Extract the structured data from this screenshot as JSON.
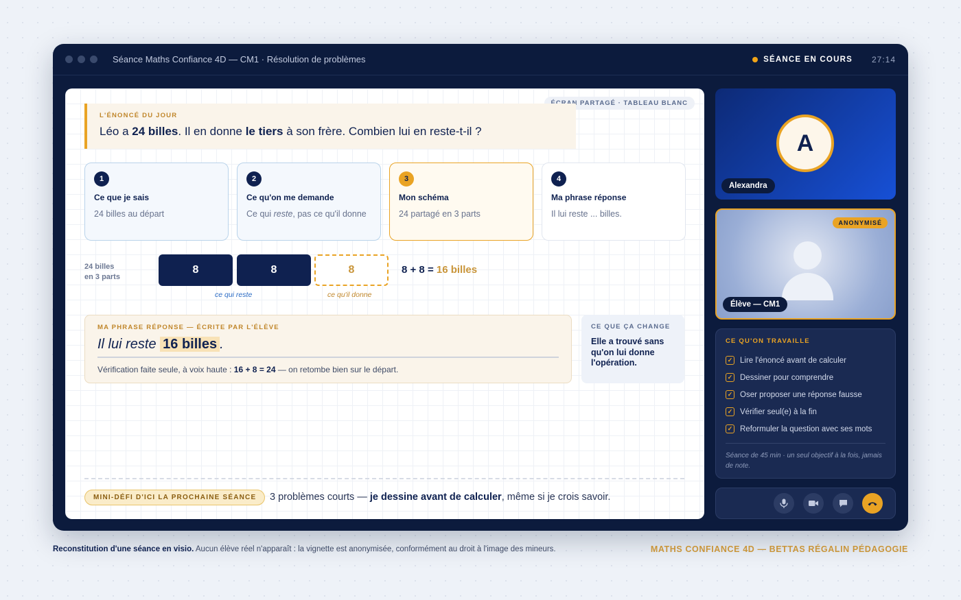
{
  "window": {
    "title": "Séance Maths Confiance 4D — CM1 · Résolution de problèmes",
    "status": "SÉANCE EN COURS",
    "timer": "27:14"
  },
  "board": {
    "share_tag": "ÉCRAN PARTAGÉ · TABLEAU BLANC",
    "enonce": {
      "kicker": "L'ÉNONCÉ DU JOUR",
      "p1": "Léo a ",
      "b1": "24 billes",
      "p2": ". Il en donne ",
      "b2": "le tiers",
      "p3": " à son frère. Combien lui en reste-t-il ?"
    },
    "steps": [
      {
        "num": "1",
        "title": "Ce que je sais",
        "desc": "24 billes au départ"
      },
      {
        "num": "2",
        "title": "Ce qu'on me demande",
        "desc_a": "Ce qui ",
        "desc_i": "reste",
        "desc_b": ", pas ce qu'il donne"
      },
      {
        "num": "3",
        "title": "Mon schéma",
        "desc": "24 partagé en 3 parts"
      },
      {
        "num": "4",
        "title": "Ma phrase réponse",
        "desc": "Il lui reste ... billes."
      }
    ],
    "schema": {
      "label_line1": "24 billes",
      "label_line2": "en 3 parts",
      "segments": [
        "8",
        "8",
        "8"
      ],
      "caption_kept": "ce qui reste",
      "caption_given": "ce qu'il donne",
      "equation_left": "8 + 8 = ",
      "equation_result": "16 billes"
    },
    "answer": {
      "kicker": "MA PHRASE RÉPONSE — ÉCRITE PAR L'ÉLÈVE",
      "text_before": "Il lui reste ",
      "highlight": "16 billes",
      "text_after": ".",
      "verif_a": "Vérification faite seule, à voix haute : ",
      "verif_b": "16 + 8 = 24",
      "verif_c": " — on retombe bien sur le départ."
    },
    "change": {
      "kicker": "CE QUE ÇA CHANGE",
      "text": "Elle a trouvé sans qu'on lui donne l'opération."
    },
    "mini_defi": {
      "badge": "MINI-DÉFI D'ICI LA PROCHAINE SÉANCE",
      "text_a": "3 problèmes courts — ",
      "text_b": "je dessine avant de calculer",
      "text_c": ", même si je crois savoir."
    }
  },
  "video": {
    "teacher": {
      "initial": "A",
      "name": "Alexandra"
    },
    "student": {
      "badge": "ANONYMISÉ",
      "name": "Élève — CM1"
    }
  },
  "panel": {
    "kicker": "CE QU'ON TRAVAILLE",
    "items": [
      "Lire l'énoncé avant de calculer",
      "Dessiner pour comprendre",
      "Oser proposer une réponse fausse",
      "Vérifier seul(e) à la fin",
      "Reformuler la question avec ses mots"
    ],
    "note": "Séance de 45 min · un seul objectif à la fois, jamais de note."
  },
  "controls": [
    "mic-icon",
    "camera-icon",
    "chat-icon",
    "hang-up-icon"
  ],
  "footer": {
    "left_bold": "Reconstitution d'une séance en visio.",
    "left_text": " Aucun élève réel n'apparaît : la vignette est anonymisée, conformément au droit à l'image des mineurs.",
    "right": "MATHS CONFIANCE 4D — BETTAS RÉGALIN PÉDAGOGIE"
  },
  "colors": {
    "navy": "#0c1b3d",
    "gold": "#e9a324",
    "blue": "#1750d6"
  }
}
